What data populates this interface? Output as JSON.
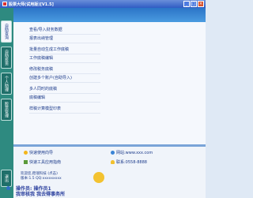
{
  "window": {
    "title": "股票大师(试用版)[V1.5]"
  },
  "leftbar": {
    "tabs": [
      "自助查询",
      "自助投资",
      "个人助理",
      "股票管理",
      "退出"
    ]
  },
  "menu": {
    "items": [
      "查看/导入财务数据",
      "报表出纳管理",
      "批量自动生成工作底稿",
      "工作底稿编辑",
      "修改税务底稿",
      "创建多个账户(自助导入)",
      "多人同时的底稿",
      "底稿编辑",
      "样稿计算模型印表"
    ]
  },
  "links": {
    "quick": "快速使用向导",
    "online": "快速工具应用指南",
    "site": "网站:www.xxx.com",
    "help": "联系:0558-8888"
  },
  "info": {
    "line1": "欢迎您,稳瑞科技 (点击)",
    "line2": "版本:1.5   QQ:xxxxxxxxx"
  },
  "message": {
    "line1": "操作员: 操作员1",
    "line2": "我审核我 我去得事务所"
  }
}
